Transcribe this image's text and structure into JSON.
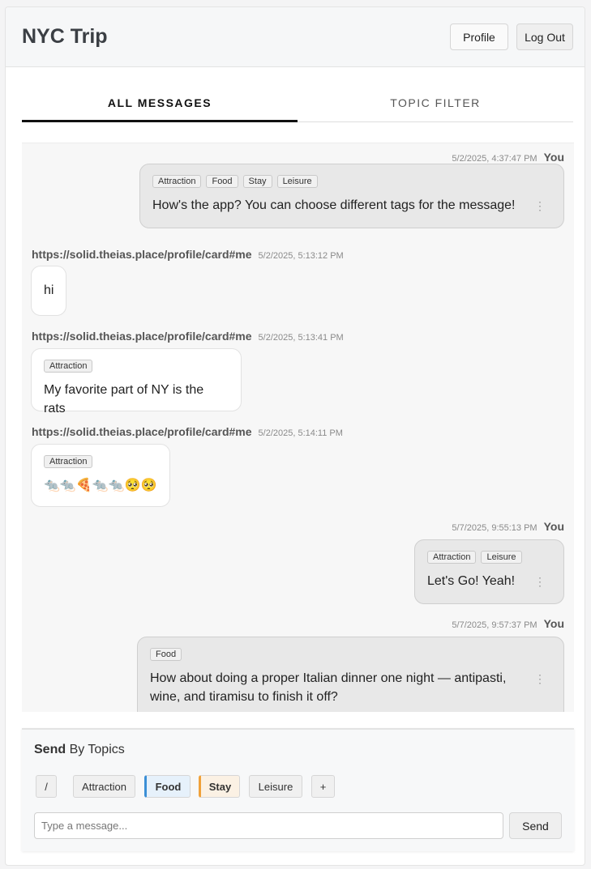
{
  "header": {
    "title": "NYC Trip",
    "profile_label": "Profile",
    "logout_label": "Log Out"
  },
  "tabs": [
    {
      "label": "ALL MESSAGES",
      "active": true
    },
    {
      "label": "TOPIC FILTER",
      "active": false
    }
  ],
  "messages": [
    {
      "from": "You",
      "timestamp": "5/2/2025, 4:37:47 PM",
      "tags": [
        "Attraction",
        "Food",
        "Stay",
        "Leisure"
      ],
      "text": "How's the app? You can choose different tags for the message!",
      "menu_icon": "kebab-icon"
    },
    {
      "from": "https://solid.theias.place/profile/card#me",
      "timestamp": "5/2/2025, 5:13:12 PM",
      "tags": [],
      "text": "hi"
    },
    {
      "from": "https://solid.theias.place/profile/card#me",
      "timestamp": "5/2/2025, 5:13:41 PM",
      "tags": [
        "Attraction"
      ],
      "text": "My favorite part of NY is the rats"
    },
    {
      "from": "https://solid.theias.place/profile/card#me",
      "timestamp": "5/2/2025, 5:14:11 PM",
      "tags": [
        "Attraction"
      ],
      "text": "🐀🐀🍕🐀🐀🥺🥺"
    },
    {
      "from": "You",
      "timestamp": "5/7/2025, 9:55:13 PM",
      "tags": [
        "Attraction",
        "Leisure"
      ],
      "text": "Let's Go! Yeah!",
      "menu_icon": "kebab-icon"
    },
    {
      "from": "You",
      "timestamp": "5/7/2025, 9:57:37 PM",
      "tags": [
        "Food"
      ],
      "text": "How about doing a proper Italian dinner one night — antipasti, wine, and tiramisu to finish it off?",
      "menu_icon": "kebab-icon"
    }
  ],
  "compose": {
    "label_bold": "Send",
    "label_rest": "By Topics",
    "topics": [
      {
        "label": "/",
        "selected": false
      },
      {
        "label": "Attraction",
        "selected": false
      },
      {
        "label": "Food",
        "selected": true,
        "accent": "#3b8fd6"
      },
      {
        "label": "Stay",
        "selected": true,
        "accent": "#f0a13a"
      },
      {
        "label": "Leisure",
        "selected": false
      },
      {
        "label": "+",
        "selected": false
      }
    ],
    "input_placeholder": "Type a message...",
    "input_value": "",
    "send_label": "Send"
  }
}
